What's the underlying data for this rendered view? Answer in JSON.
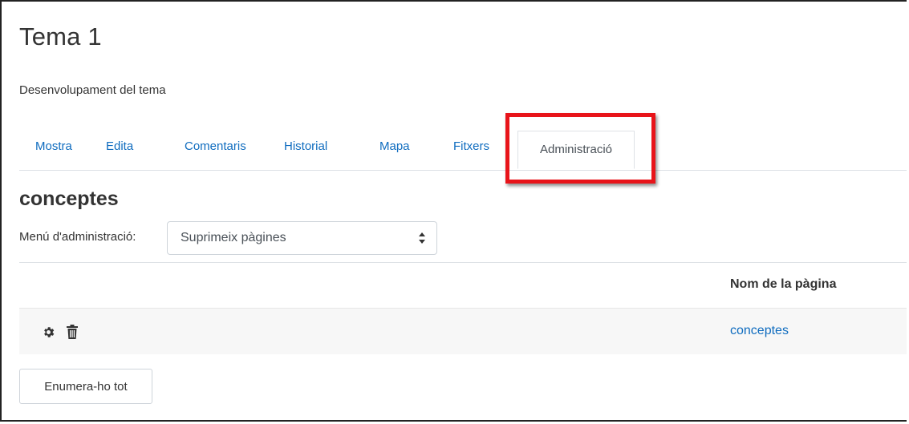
{
  "page": {
    "title": "Tema 1",
    "description": "Desenvolupament del tema"
  },
  "tabs": [
    {
      "label": "Mostra",
      "active": false
    },
    {
      "label": "Edita",
      "active": false
    },
    {
      "label": "Comentaris",
      "active": false
    },
    {
      "label": "Historial",
      "active": false
    },
    {
      "label": "Mapa",
      "active": false
    },
    {
      "label": "Fitxers",
      "active": false
    },
    {
      "label": "Administració",
      "active": true
    }
  ],
  "section": {
    "heading": "conceptes"
  },
  "admin_menu": {
    "label": "Menú d'administració:",
    "selected": "Suprimeix pàgines"
  },
  "table": {
    "column_header": "Nom de la pàgina",
    "rows": [
      {
        "page_name": "conceptes",
        "icons": [
          "gear-icon",
          "trash-icon"
        ]
      }
    ]
  },
  "list_all_button": "Enumera-ho tot",
  "colors": {
    "link": "#0f6cbf",
    "highlight": "#e8141a",
    "row_background": "#f7f7f7"
  }
}
